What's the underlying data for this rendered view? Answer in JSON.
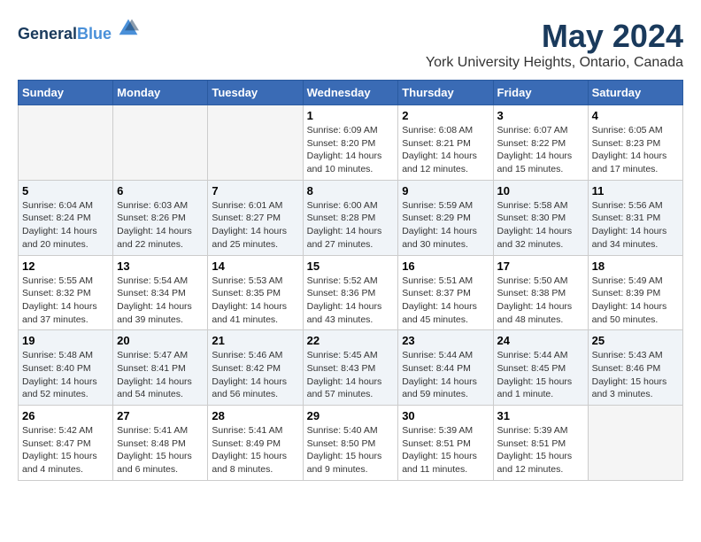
{
  "header": {
    "logo_general": "General",
    "logo_blue": "Blue",
    "month_title": "May 2024",
    "location": "York University Heights, Ontario, Canada"
  },
  "weekdays": [
    "Sunday",
    "Monday",
    "Tuesday",
    "Wednesday",
    "Thursday",
    "Friday",
    "Saturday"
  ],
  "rows": [
    {
      "alt": false,
      "days": [
        {
          "num": "",
          "detail": "",
          "empty": true
        },
        {
          "num": "",
          "detail": "",
          "empty": true
        },
        {
          "num": "",
          "detail": "",
          "empty": true
        },
        {
          "num": "1",
          "detail": "Sunrise: 6:09 AM\nSunset: 8:20 PM\nDaylight: 14 hours\nand 10 minutes.",
          "empty": false
        },
        {
          "num": "2",
          "detail": "Sunrise: 6:08 AM\nSunset: 8:21 PM\nDaylight: 14 hours\nand 12 minutes.",
          "empty": false
        },
        {
          "num": "3",
          "detail": "Sunrise: 6:07 AM\nSunset: 8:22 PM\nDaylight: 14 hours\nand 15 minutes.",
          "empty": false
        },
        {
          "num": "4",
          "detail": "Sunrise: 6:05 AM\nSunset: 8:23 PM\nDaylight: 14 hours\nand 17 minutes.",
          "empty": false
        }
      ]
    },
    {
      "alt": true,
      "days": [
        {
          "num": "5",
          "detail": "Sunrise: 6:04 AM\nSunset: 8:24 PM\nDaylight: 14 hours\nand 20 minutes.",
          "empty": false
        },
        {
          "num": "6",
          "detail": "Sunrise: 6:03 AM\nSunset: 8:26 PM\nDaylight: 14 hours\nand 22 minutes.",
          "empty": false
        },
        {
          "num": "7",
          "detail": "Sunrise: 6:01 AM\nSunset: 8:27 PM\nDaylight: 14 hours\nand 25 minutes.",
          "empty": false
        },
        {
          "num": "8",
          "detail": "Sunrise: 6:00 AM\nSunset: 8:28 PM\nDaylight: 14 hours\nand 27 minutes.",
          "empty": false
        },
        {
          "num": "9",
          "detail": "Sunrise: 5:59 AM\nSunset: 8:29 PM\nDaylight: 14 hours\nand 30 minutes.",
          "empty": false
        },
        {
          "num": "10",
          "detail": "Sunrise: 5:58 AM\nSunset: 8:30 PM\nDaylight: 14 hours\nand 32 minutes.",
          "empty": false
        },
        {
          "num": "11",
          "detail": "Sunrise: 5:56 AM\nSunset: 8:31 PM\nDaylight: 14 hours\nand 34 minutes.",
          "empty": false
        }
      ]
    },
    {
      "alt": false,
      "days": [
        {
          "num": "12",
          "detail": "Sunrise: 5:55 AM\nSunset: 8:32 PM\nDaylight: 14 hours\nand 37 minutes.",
          "empty": false
        },
        {
          "num": "13",
          "detail": "Sunrise: 5:54 AM\nSunset: 8:34 PM\nDaylight: 14 hours\nand 39 minutes.",
          "empty": false
        },
        {
          "num": "14",
          "detail": "Sunrise: 5:53 AM\nSunset: 8:35 PM\nDaylight: 14 hours\nand 41 minutes.",
          "empty": false
        },
        {
          "num": "15",
          "detail": "Sunrise: 5:52 AM\nSunset: 8:36 PM\nDaylight: 14 hours\nand 43 minutes.",
          "empty": false
        },
        {
          "num": "16",
          "detail": "Sunrise: 5:51 AM\nSunset: 8:37 PM\nDaylight: 14 hours\nand 45 minutes.",
          "empty": false
        },
        {
          "num": "17",
          "detail": "Sunrise: 5:50 AM\nSunset: 8:38 PM\nDaylight: 14 hours\nand 48 minutes.",
          "empty": false
        },
        {
          "num": "18",
          "detail": "Sunrise: 5:49 AM\nSunset: 8:39 PM\nDaylight: 14 hours\nand 50 minutes.",
          "empty": false
        }
      ]
    },
    {
      "alt": true,
      "days": [
        {
          "num": "19",
          "detail": "Sunrise: 5:48 AM\nSunset: 8:40 PM\nDaylight: 14 hours\nand 52 minutes.",
          "empty": false
        },
        {
          "num": "20",
          "detail": "Sunrise: 5:47 AM\nSunset: 8:41 PM\nDaylight: 14 hours\nand 54 minutes.",
          "empty": false
        },
        {
          "num": "21",
          "detail": "Sunrise: 5:46 AM\nSunset: 8:42 PM\nDaylight: 14 hours\nand 56 minutes.",
          "empty": false
        },
        {
          "num": "22",
          "detail": "Sunrise: 5:45 AM\nSunset: 8:43 PM\nDaylight: 14 hours\nand 57 minutes.",
          "empty": false
        },
        {
          "num": "23",
          "detail": "Sunrise: 5:44 AM\nSunset: 8:44 PM\nDaylight: 14 hours\nand 59 minutes.",
          "empty": false
        },
        {
          "num": "24",
          "detail": "Sunrise: 5:44 AM\nSunset: 8:45 PM\nDaylight: 15 hours\nand 1 minute.",
          "empty": false
        },
        {
          "num": "25",
          "detail": "Sunrise: 5:43 AM\nSunset: 8:46 PM\nDaylight: 15 hours\nand 3 minutes.",
          "empty": false
        }
      ]
    },
    {
      "alt": false,
      "days": [
        {
          "num": "26",
          "detail": "Sunrise: 5:42 AM\nSunset: 8:47 PM\nDaylight: 15 hours\nand 4 minutes.",
          "empty": false
        },
        {
          "num": "27",
          "detail": "Sunrise: 5:41 AM\nSunset: 8:48 PM\nDaylight: 15 hours\nand 6 minutes.",
          "empty": false
        },
        {
          "num": "28",
          "detail": "Sunrise: 5:41 AM\nSunset: 8:49 PM\nDaylight: 15 hours\nand 8 minutes.",
          "empty": false
        },
        {
          "num": "29",
          "detail": "Sunrise: 5:40 AM\nSunset: 8:50 PM\nDaylight: 15 hours\nand 9 minutes.",
          "empty": false
        },
        {
          "num": "30",
          "detail": "Sunrise: 5:39 AM\nSunset: 8:51 PM\nDaylight: 15 hours\nand 11 minutes.",
          "empty": false
        },
        {
          "num": "31",
          "detail": "Sunrise: 5:39 AM\nSunset: 8:51 PM\nDaylight: 15 hours\nand 12 minutes.",
          "empty": false
        },
        {
          "num": "",
          "detail": "",
          "empty": true
        }
      ]
    }
  ]
}
